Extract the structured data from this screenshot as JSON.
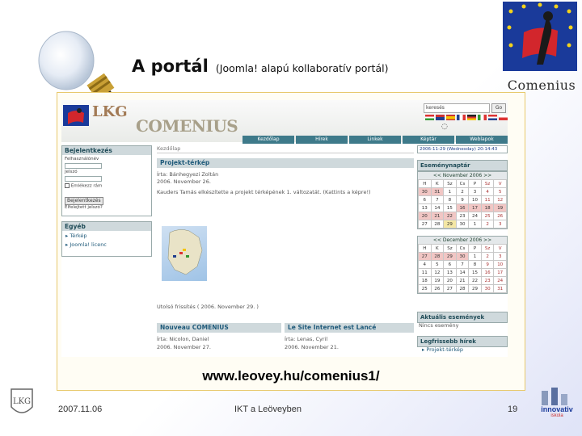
{
  "slide": {
    "title_main": "A portál",
    "title_sub": "(Joomla! alapú kollaboratív portál)",
    "logo_word": "Comenius",
    "url": "www.leovey.hu/comenius1/",
    "date": "2007.11.06",
    "footer_text": "IKT a Leöveyben",
    "page_number": "19",
    "inno_label": "innovativ",
    "inno_sub": "iskola"
  },
  "site": {
    "logo_lkg": "LKG",
    "logo_comenius": "COMENIUS",
    "search_value": "keresés",
    "go_label": "Go",
    "nav": [
      "Kezdőlap",
      "Hírek",
      "Linkek",
      "Képtár",
      "Weblapok"
    ],
    "breadcrumb": "Kezdőlap",
    "login": {
      "title": "Bejelentkezés",
      "username_label": "Felhasználónév",
      "password_label": "Jelszó",
      "remember_label": "Emlékezz rám",
      "button": "Bejelentkezés",
      "forgot": "Elfelejtett jelszó?"
    },
    "other": {
      "title": "Egyéb",
      "items": [
        "Térkép",
        "Joomla! licenc"
      ]
    },
    "article": {
      "title": "Projekt-térkép",
      "author": "Írta: Bánhegyezi Zoltán",
      "date": "2006. November 26.",
      "body": "Kauders Tamás elkészítette a projekt térképének 1. változatát. (Kattints a képre!)",
      "updated": "Utolsó frissítés ( 2006. November 29. )"
    },
    "news": [
      {
        "title": "Nouveau COMENIUS",
        "author": "Írta: Nicolon, Daniel",
        "date": "2006. November 27."
      },
      {
        "title": "Le Site Internet est Lancé",
        "author": "Írta: Lenas, Cyril",
        "date": "2006. November 21."
      }
    ],
    "datetime": "2006-11-29 (Wednesday) 20:14:43",
    "calendar_title": "Eseménynaptár",
    "cal1_head": "<< November 2006 >>",
    "cal2_head": "<< December 2006 >>",
    "weekdays": [
      "H",
      "K",
      "Sz",
      "Cs",
      "P",
      "Sz",
      "V"
    ],
    "cal1": [
      [
        "30",
        "31",
        "1",
        "2",
        "3",
        "4",
        "5"
      ],
      [
        "6",
        "7",
        "8",
        "9",
        "10",
        "11",
        "12"
      ],
      [
        "13",
        "14",
        "15",
        "16",
        "17",
        "18",
        "19"
      ],
      [
        "20",
        "21",
        "22",
        "23",
        "24",
        "25",
        "26"
      ],
      [
        "27",
        "28",
        "29",
        "30",
        "1",
        "2",
        "3"
      ]
    ],
    "cal2": [
      [
        "27",
        "28",
        "29",
        "30",
        "1",
        "2",
        "3"
      ],
      [
        "4",
        "5",
        "6",
        "7",
        "8",
        "9",
        "10"
      ],
      [
        "11",
        "12",
        "13",
        "14",
        "15",
        "16",
        "17"
      ],
      [
        "18",
        "19",
        "20",
        "21",
        "22",
        "23",
        "24"
      ],
      [
        "25",
        "26",
        "27",
        "28",
        "29",
        "30",
        "31"
      ]
    ],
    "events_title": "Aktuális események",
    "events_item": "Nincs esemény",
    "latest_title": "Legfrissebb hírek",
    "latest_item": "Projekt-térkép"
  },
  "colors": {
    "nav_bg": "#3e7a8a",
    "frame_border": "#e8c96c"
  }
}
